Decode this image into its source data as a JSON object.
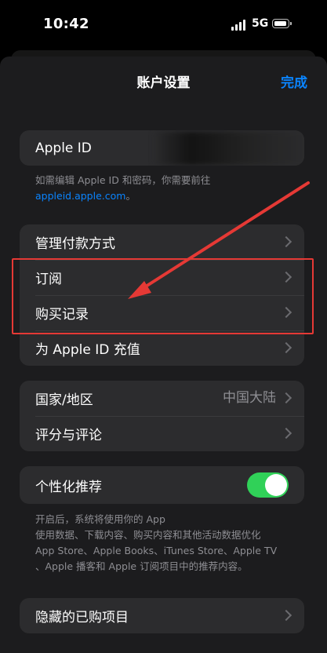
{
  "status": {
    "time": "10:42",
    "network": "5G"
  },
  "nav": {
    "title": "账户设置",
    "done_label": "完成"
  },
  "apple_id": {
    "label": "Apple ID",
    "note": "如需编辑 Apple ID 和密码，你需要前往",
    "link": "appleid.apple.com",
    "link_suffix": "。"
  },
  "payments_group": {
    "items": [
      {
        "label": "管理付款方式"
      },
      {
        "label": "订阅"
      },
      {
        "label": "购买记录"
      },
      {
        "label": "为 Apple ID 充值"
      }
    ]
  },
  "region_group": {
    "items": [
      {
        "label": "国家/地区",
        "value": "中国大陆"
      },
      {
        "label": "评分与评论"
      }
    ]
  },
  "personalized": {
    "label": "个性化推荐",
    "enabled": true,
    "footnote_lines": [
      "开启后，系统将使用你的 App",
      "使用数据、下载内容、购买内容和其他活动数据优化",
      "App Store、Apple Books、iTunes Store、Apple TV",
      "、Apple 播客和 Apple 订阅项目中的推荐内容。"
    ]
  },
  "hidden_purchases": {
    "label": "隐藏的已购项目"
  },
  "colors": {
    "accent": "#0a84ff",
    "toggle_on": "#30d158",
    "annotation": "#e53935"
  }
}
